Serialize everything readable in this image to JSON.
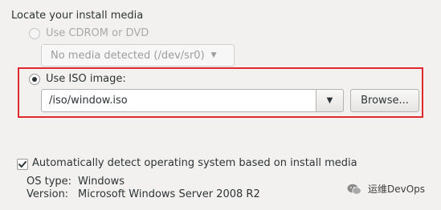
{
  "section": {
    "title": "Locate your install media"
  },
  "cdrom": {
    "label": "Use CDROM or DVD",
    "combo_value": "No media detected (/dev/sr0)",
    "enabled": false,
    "selected": false
  },
  "iso": {
    "label": "Use ISO image:",
    "selected": true,
    "path_value": "/iso/window.iso",
    "browse_label": "Browse..."
  },
  "autodetect": {
    "label": "Automatically detect operating system based on install media",
    "checked": true
  },
  "os_info": {
    "type_label": "OS type:",
    "type_value": "Windows",
    "version_label": "Version:",
    "version_value": "Microsoft Windows Server 2008 R2"
  },
  "watermark": {
    "text": "运维DevOps",
    "icon": "wechat-icon"
  },
  "colors": {
    "highlight_frame": "#e0282e",
    "background": "#f2f1f0"
  }
}
